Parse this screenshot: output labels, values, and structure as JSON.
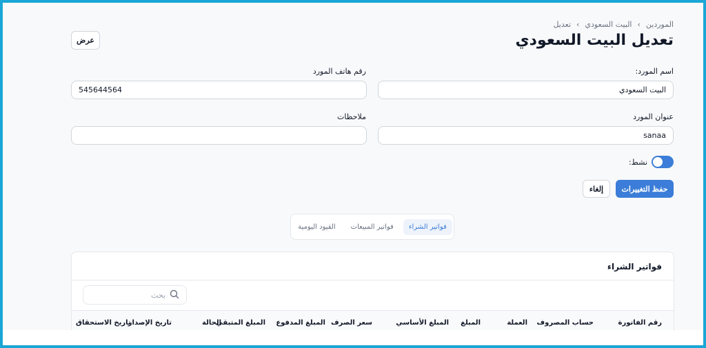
{
  "breadcrumb": {
    "items": [
      "الموردين",
      "البيت السعودي",
      "تعديل"
    ]
  },
  "header": {
    "title": "تعديل البيت السعودي",
    "view_label": "عرض"
  },
  "form": {
    "supplier_name_label": "اسم المورد:",
    "supplier_name_value": "البيت السعودي",
    "supplier_phone_label": "رقم هاتف المورد",
    "supplier_phone_value": "545644564",
    "supplier_address_label": "عنوان المورد",
    "supplier_address_value": "sanaa",
    "notes_label": "ملاحظات",
    "notes_value": "",
    "active_label": "نشط:",
    "active_on": true
  },
  "actions": {
    "save_label": "حفظ التغييرات",
    "cancel_label": "إلغاء"
  },
  "tabs": [
    {
      "label": "فواتير الشراء",
      "active": true
    },
    {
      "label": "فواتير المبيعات",
      "active": false
    },
    {
      "label": "القيود اليومية",
      "active": false
    }
  ],
  "purchase_invoices": {
    "title": "فواتير الشراء",
    "search_placeholder": "بحث",
    "columns": [
      "رقم الفاتورة",
      "حساب المصروف",
      "العملة",
      "المبلغ",
      "المبلغ الأساسي",
      "سعر الصرف",
      "المبلغ المدفوع",
      "المبلغ المتبقي",
      "الحالة",
      "تاريخ الإصدار",
      "تاريخ الاستحقاق"
    ]
  },
  "colors": {
    "accent": "#3b7dd8",
    "frame": "#1aa7d6"
  }
}
